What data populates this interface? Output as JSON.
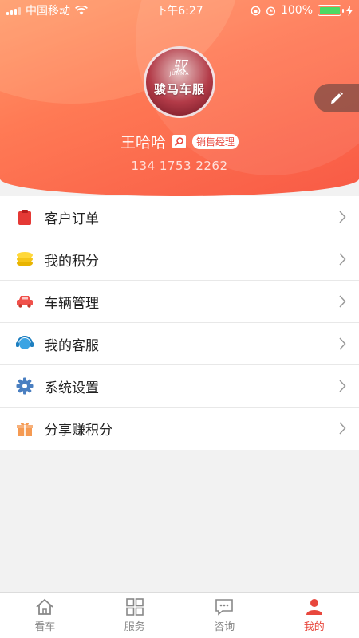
{
  "status_bar": {
    "carrier": "中国移动",
    "time": "下午6:27",
    "battery": "100%"
  },
  "profile": {
    "avatar_logo_script": "驭",
    "avatar_logo_small": "JUNMA",
    "avatar_logo_text": "骏马车服",
    "name": "王哈哈",
    "role": "销售经理",
    "phone": "134 1753 2262"
  },
  "menu": [
    {
      "label": "客户订单",
      "icon": "clipboard-icon",
      "color": "#e53935"
    },
    {
      "label": "我的积分",
      "icon": "coins-icon",
      "color": "#f5c518"
    },
    {
      "label": "车辆管理",
      "icon": "car-icon",
      "color": "#f0504a"
    },
    {
      "label": "我的客服",
      "icon": "headset-icon",
      "color": "#3aa3e3"
    },
    {
      "label": "系统设置",
      "icon": "gear-icon",
      "color": "#4a7fc1"
    },
    {
      "label": "分享赚积分",
      "icon": "gift-icon",
      "color": "#f59a52"
    }
  ],
  "tabbar": {
    "tabs": [
      {
        "label": "看车",
        "icon": "home-icon"
      },
      {
        "label": "服务",
        "icon": "grid-icon"
      },
      {
        "label": "咨询",
        "icon": "chat-icon"
      },
      {
        "label": "我的",
        "icon": "user-icon",
        "active": true
      }
    ]
  },
  "colors": {
    "accent": "#e8473d",
    "header_gradient_start": "#ff9a6b",
    "header_gradient_end": "#f85a45"
  }
}
